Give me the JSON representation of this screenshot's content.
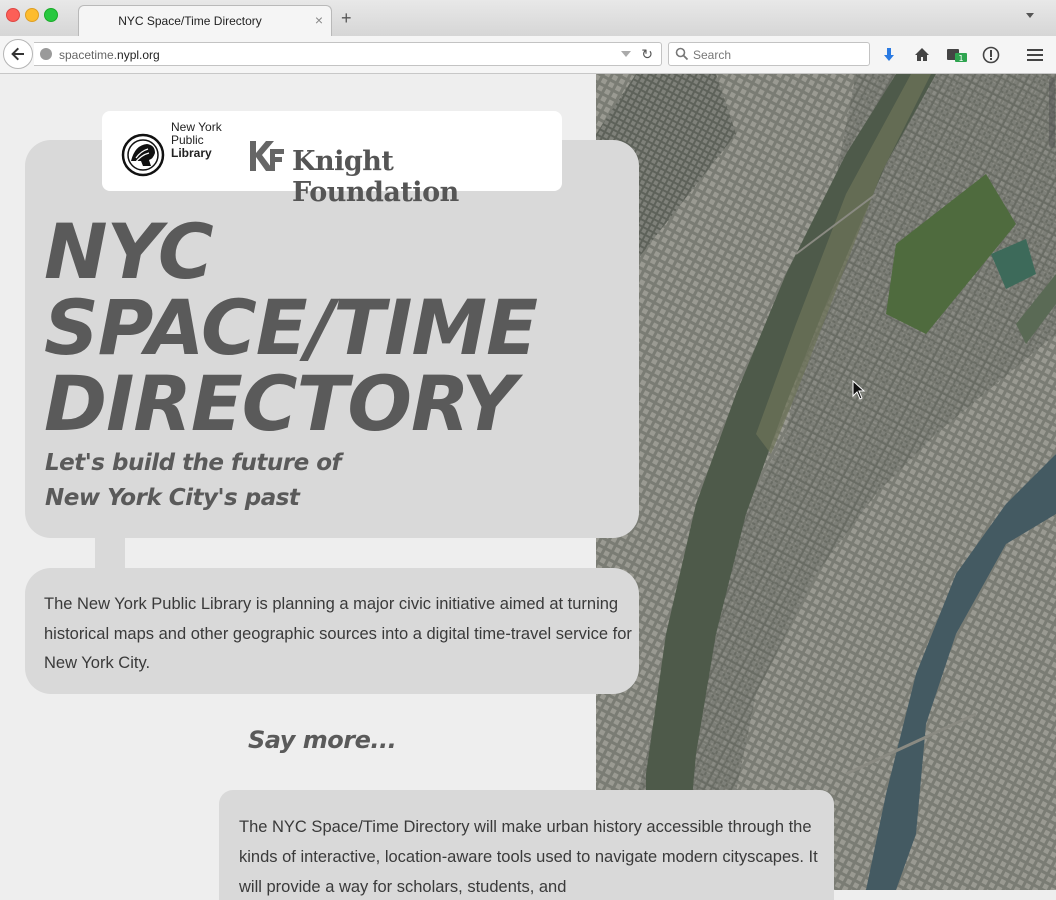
{
  "browser": {
    "tab_title": "NYC Space/Time Directory",
    "tab_close": "×",
    "new_tab": "+",
    "url_domain_prefix": "spacetime.",
    "url_domain_main": "nypl.org",
    "search_placeholder": "Search",
    "reload_glyph": "↻"
  },
  "logos": {
    "nypl_line1": "New York",
    "nypl_line2": "Public",
    "nypl_line3": "Library",
    "knight": "Knight Foundation"
  },
  "hero": {
    "title_line1": "NYC",
    "title_line2": "SPACE/TIME",
    "title_line3": "DIRECTORY",
    "subtitle_line1": "Let's build the future of",
    "subtitle_line2": "New York City's past"
  },
  "intro": {
    "text": "The New York Public Library is planning a major civic initiative aimed at turning historical maps and other geographic sources into a digital time-travel service for New York City."
  },
  "more": {
    "heading": "Say more...",
    "text": "The NYC Space/Time Directory will make urban history accessible through the kinds of interactive, location-aware tools used to navigate modern cityscapes. It will provide a way for scholars, students, and"
  },
  "colors": {
    "card": "#d9d9d9",
    "title_text": "#5a5a5a",
    "body_text": "#3a3a3a",
    "download_accent": "#2a7ae2",
    "badge_green": "#2ea44f"
  },
  "icons": {
    "download": "download-icon",
    "home": "home-icon",
    "extension": "extension-badge-icon",
    "info": "info-icon",
    "menu": "hamburger-menu-icon"
  },
  "extension_badge_count": "1"
}
